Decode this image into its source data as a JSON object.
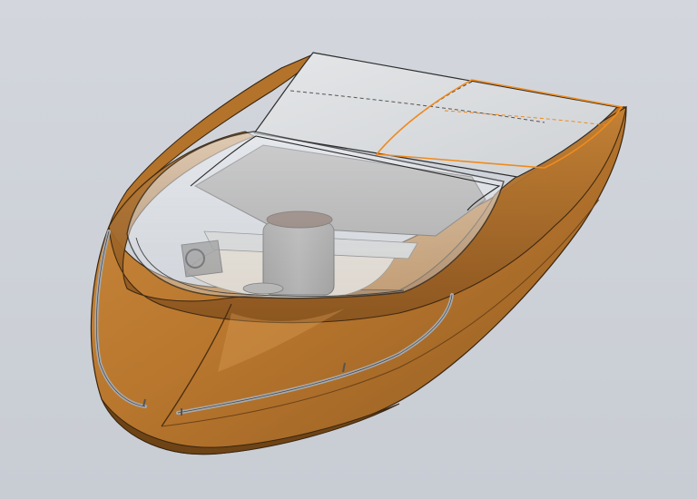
{
  "viewport": {
    "background": "#cdd1d8",
    "selection_color": "#f08a1c"
  },
  "model": {
    "hull_color": "#b9772e",
    "hull_shadow": "#7a4b18",
    "hull_highlight": "#dca15a",
    "deck_color": "#d9dcdf",
    "windshield_tint": "#e6e9ee",
    "seat_color": "#8d8a87",
    "headrest_color": "#5a3b2c",
    "rail_color": "#a7aaad",
    "cockpit_floor": "#e2d6c5"
  }
}
